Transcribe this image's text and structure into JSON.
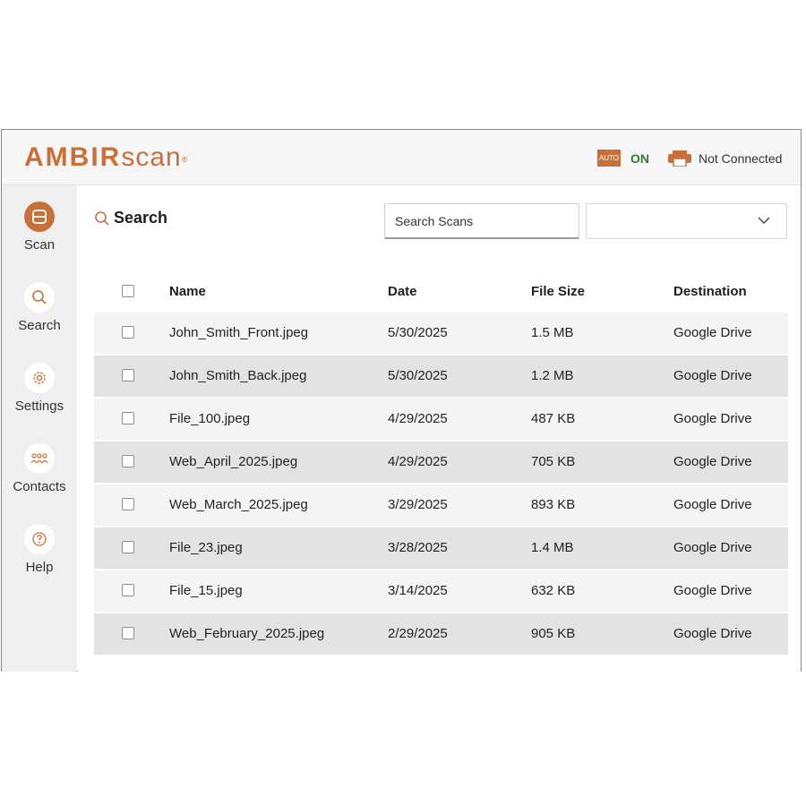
{
  "header": {
    "logo_bold": "AMBIR",
    "logo_light": "scan",
    "logo_mark": "®",
    "auto_badge": "AUTO",
    "auto_status": "ON",
    "printer_status": "Not Connected"
  },
  "sidebar": {
    "items": [
      {
        "label": "Scan",
        "icon": "scan-icon",
        "active": true
      },
      {
        "label": "Search",
        "icon": "search-icon"
      },
      {
        "label": "Settings",
        "icon": "gear-icon"
      },
      {
        "label": "Contacts",
        "icon": "contacts-icon"
      },
      {
        "label": "Help",
        "icon": "help-icon"
      }
    ]
  },
  "main": {
    "title": "Search",
    "search": {
      "placeholder": "Search Scans",
      "value": ""
    },
    "dropdown": {
      "value": ""
    }
  },
  "table": {
    "headers": {
      "name": "Name",
      "date": "Date",
      "size": "File Size",
      "destination": "Destination"
    },
    "rows": [
      {
        "name": "John_Smith_Front.jpeg",
        "date": "5/30/2025",
        "size": "1.5 MB",
        "destination": "Google Drive"
      },
      {
        "name": "John_Smith_Back.jpeg",
        "date": "5/30/2025",
        "size": "1.2 MB",
        "destination": "Google Drive"
      },
      {
        "name": "File_100.jpeg",
        "date": "4/29/2025",
        "size": "487 KB",
        "destination": "Google Drive"
      },
      {
        "name": "Web_April_2025.jpeg",
        "date": "4/29/2025",
        "size": "705 KB",
        "destination": "Google Drive"
      },
      {
        "name": "Web_March_2025.jpeg",
        "date": "3/29/2025",
        "size": "893 KB",
        "destination": "Google Drive"
      },
      {
        "name": "File_23.jpeg",
        "date": "3/28/2025",
        "size": "1.4 MB",
        "destination": "Google Drive"
      },
      {
        "name": "File_15.jpeg",
        "date": "3/14/2025",
        "size": "632 KB",
        "destination": "Google Drive"
      },
      {
        "name": "Web_February_2025.jpeg",
        "date": "2/29/2025",
        "size": "905 KB",
        "destination": "Google Drive"
      }
    ]
  },
  "colors": {
    "accent": "#c8703a",
    "on_status": "#2e7d32",
    "row_light": "#f4f4f4",
    "row_dark": "#e3e3e3",
    "sidebar_bg": "#efefef"
  }
}
